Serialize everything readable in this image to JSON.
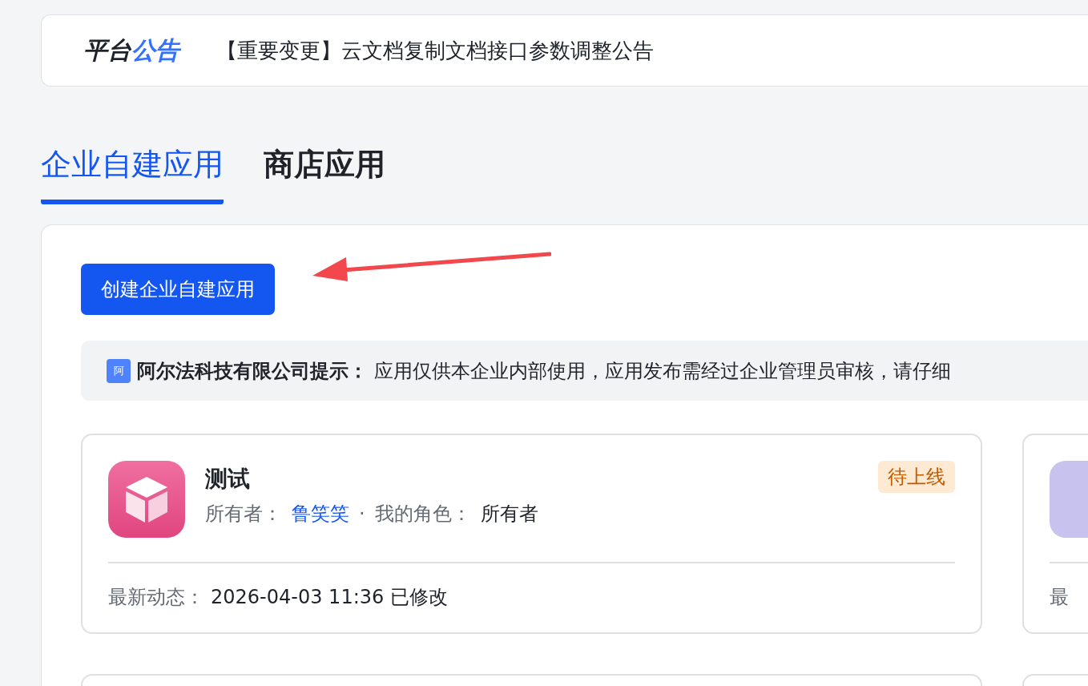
{
  "announcement": {
    "label_dark": "平台",
    "label_accent": "公告",
    "text": "【重要变更】云文档复制文档接口参数调整公告"
  },
  "tabs": [
    {
      "label": "企业自建应用",
      "selected": true
    },
    {
      "label": "商店应用",
      "selected": false
    }
  ],
  "create_button": "创建企业自建应用",
  "notice": {
    "badge": "阿",
    "title": "阿尔法科技有限公司提示：",
    "text": "应用仅供本企业内部使用，应用发布需经过企业管理员审核，请仔细"
  },
  "apps": [
    {
      "kind": "full",
      "name": "测试",
      "status": "待上线",
      "owner_label": "所有者：",
      "owner": "鲁笑笑",
      "separator": "·",
      "role_label": "我的角色：",
      "role": "所有者",
      "activity_label": "最新动态：",
      "activity": "2026-04-03 11:36 已修改"
    },
    {
      "kind": "partial",
      "activity_label": "最"
    },
    {
      "kind": "empty"
    },
    {
      "kind": "empty"
    }
  ]
}
